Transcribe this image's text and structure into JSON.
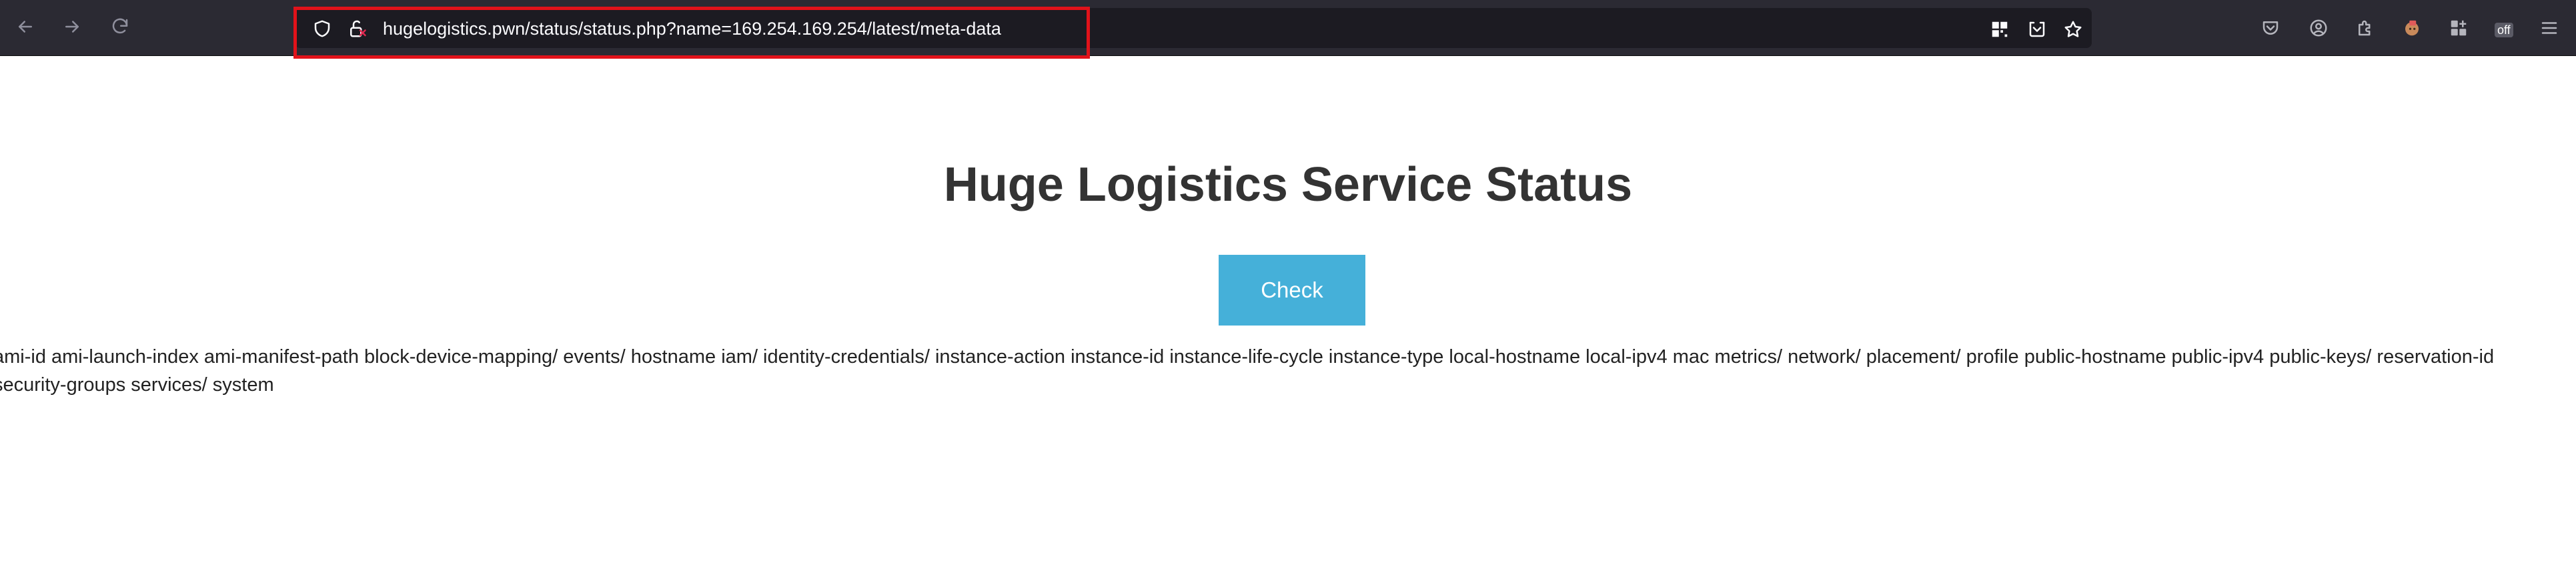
{
  "browser": {
    "url": "hugelogistics.pwn/status/status.php?name=169.254.169.254/latest/meta-data",
    "extension_badge": "off"
  },
  "icons": {
    "back": "arrow-left-icon",
    "forward": "arrow-right-icon",
    "reload": "reload-icon",
    "tracking_protection": "shield-icon",
    "connection": "lock-warning-icon",
    "qr": "qr-code-icon",
    "pocket_save": "save-to-pocket-icon",
    "bookmark": "star-icon",
    "pocket": "pocket-icon",
    "account": "account-icon",
    "extensions": "puzzle-icon",
    "extension_avatar": "extension-avatar-icon",
    "extension_grid": "extension-grid-icon",
    "extension_off": "extension-off-icon",
    "menu": "hamburger-menu-icon"
  },
  "colors": {
    "toolbar_bg": "#2b2a33",
    "urlbar_bg": "#1c1b22",
    "highlight": "#e1121a",
    "button_bg": "#45b0d9",
    "title_color": "#333333"
  },
  "page": {
    "title": "Huge Logistics Service Status",
    "check_button": "Check",
    "result": "ami-id ami-launch-index ami-manifest-path block-device-mapping/ events/ hostname iam/ identity-credentials/ instance-action instance-id instance-life-cycle instance-type local-hostname local-ipv4 mac metrics/ network/ placement/ profile public-hostname public-ipv4 public-keys/ reservation-id security-groups services/ system"
  }
}
